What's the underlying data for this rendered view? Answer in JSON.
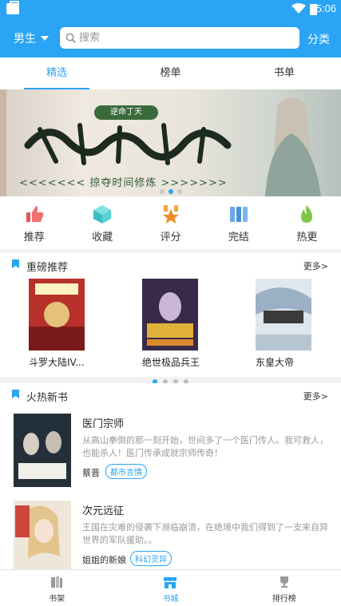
{
  "status_bar": {
    "time": "5:06"
  },
  "header": {
    "gender_label": "男生",
    "search_placeholder": "搜索",
    "category_label": "分类",
    "accent_color": "#2aa4f4"
  },
  "tabs": [
    {
      "label": "精选",
      "active": true
    },
    {
      "label": "榜单",
      "active": false
    },
    {
      "label": "书单",
      "active": false
    }
  ],
  "banner": {
    "tag": "逆命丁天",
    "headline": "转世升仙",
    "subline": "<<<<<<<  掠夺时间修炼  >>>>>>>",
    "active_dot": 1,
    "dot_count": 3
  },
  "quick_nav": [
    {
      "label": "推荐",
      "icon": "thumbs-up-icon"
    },
    {
      "label": "收藏",
      "icon": "cube-icon"
    },
    {
      "label": "评分",
      "icon": "star-badge-icon"
    },
    {
      "label": "完结",
      "icon": "books-icon"
    },
    {
      "label": "热更",
      "icon": "flame-icon"
    }
  ],
  "featured": {
    "title": "重磅推荐",
    "more": "更多>",
    "books": [
      {
        "name": "斗罗大陆IV...",
        "cover_color": "#b8302a"
      },
      {
        "name": "绝世极品兵王",
        "cover_color": "#3a2a4a"
      },
      {
        "name": "东皇大帝",
        "cover_color": "#dfe6ec"
      }
    ],
    "page_dots": 4,
    "active_page": 0
  },
  "hot_new": {
    "title": "火热新书",
    "more": "更多>",
    "books": [
      {
        "name": "医门宗师",
        "desc": "从高山拳倒的那一刻开始，世间多了一个医门传人。我可救人，也能杀人！医门传承成就宗师传奇！",
        "author": "蔡晋",
        "tag": "都市言情"
      },
      {
        "name": "次元远征",
        "desc": "王国在灾难的侵袭下濒临崩溃，在绝境中我们得到了一支来自异世界的军队援助。。",
        "author": "姐姐的新娘",
        "tag": "科幻灵异"
      }
    ]
  },
  "bottom_nav": [
    {
      "label": "书架",
      "icon": "bookshelf-icon",
      "active": false
    },
    {
      "label": "书城",
      "icon": "store-icon",
      "active": true
    },
    {
      "label": "排行榜",
      "icon": "trophy-icon",
      "active": false
    }
  ]
}
